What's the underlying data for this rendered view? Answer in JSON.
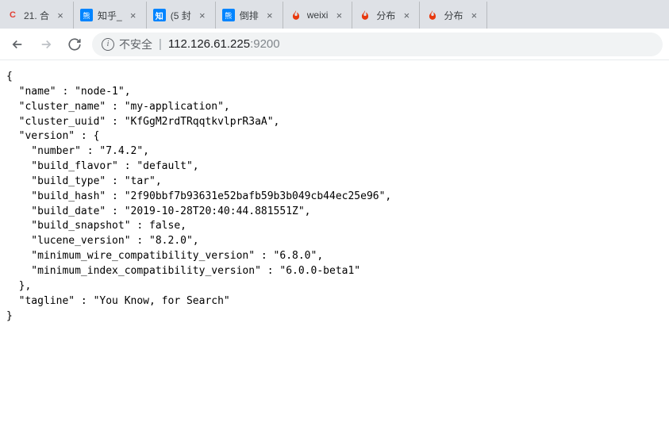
{
  "tabs": [
    {
      "title": "21. 合",
      "favicon": "csdn"
    },
    {
      "title": "知乎_",
      "favicon": "zhihu-bear"
    },
    {
      "title": "(5 封",
      "favicon": "zhihu"
    },
    {
      "title": "倒排",
      "favicon": "zhihu-bear"
    },
    {
      "title": "weixi",
      "favicon": "fire"
    },
    {
      "title": "分布",
      "favicon": "fire"
    },
    {
      "title": "分布",
      "favicon": "fire"
    }
  ],
  "address": {
    "not_secure": "不安全",
    "host": "112.126.61.225",
    "port": ":9200"
  },
  "response": {
    "name": "node-1",
    "cluster_name": "my-application",
    "cluster_uuid": "KfGgM2rdTRqqtkvlprR3aA",
    "version": {
      "number": "7.4.2",
      "build_flavor": "default",
      "build_type": "tar",
      "build_hash": "2f90bbf7b93631e52bafb59b3b049cb44ec25e96",
      "build_date": "2019-10-28T20:40:44.881551Z",
      "build_snapshot": "false",
      "lucene_version": "8.2.0",
      "minimum_wire_compatibility_version": "6.8.0",
      "minimum_index_compatibility_version": "6.0.0-beta1"
    },
    "tagline": "You Know, for Search"
  }
}
